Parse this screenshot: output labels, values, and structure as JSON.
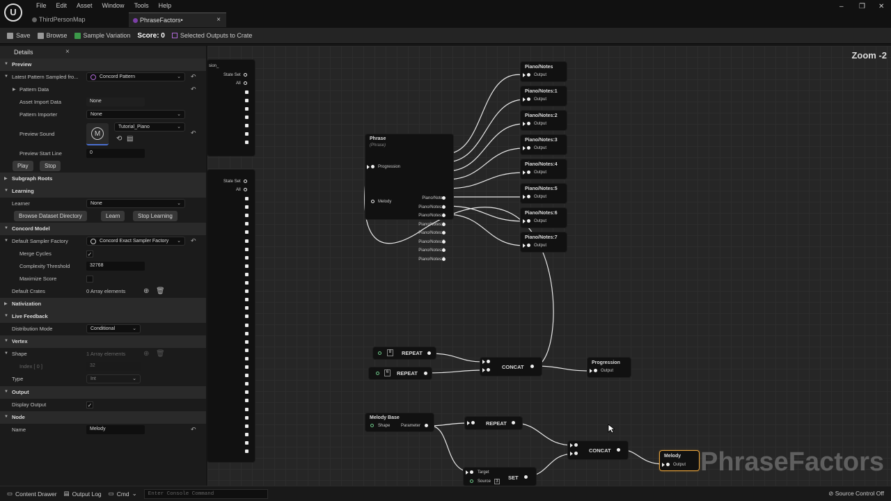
{
  "menu": [
    "File",
    "Edit",
    "Asset",
    "Window",
    "Tools",
    "Help"
  ],
  "tabs": [
    {
      "label": "ThirdPersonMap"
    },
    {
      "label": "PhraseFactors•"
    }
  ],
  "toolbar": {
    "save": "Save",
    "browse": "Browse",
    "sample_variation": "Sample Variation",
    "score": "Score: 0",
    "selected_outputs": "Selected Outputs to Crate"
  },
  "details": {
    "tab_label": "Details",
    "close": "×",
    "preview_section": "Preview",
    "latest_pattern_label": "Latest Pattern Sampled fro...",
    "latest_pattern_value": "Concord Pattern",
    "pattern_data": "Pattern Data",
    "asset_import_label": "Asset Import Data",
    "asset_import_value": "None",
    "pattern_importer_label": "Pattern Importer",
    "pattern_importer_value": "None",
    "preview_sound_label": "Preview Sound",
    "preview_sound_value": "Tutorial_Piano",
    "preview_start_label": "Preview Start Line",
    "preview_start_value": "0",
    "play": "Play",
    "stop": "Stop",
    "subgraph_roots": "Subgraph Roots",
    "learning_section": "Learning",
    "learner_label": "Learner",
    "learner_value": "None",
    "browse_dataset": "Browse Dataset Directory",
    "learn": "Learn",
    "stop_learning": "Stop Learning",
    "concord_model": "Concord Model",
    "default_sampler_label": "Default Sampler Factory",
    "default_sampler_value": "Concord Exact Sampler Factory",
    "merge_cycles": "Merge Cycles",
    "complexity_label": "Complexity Threshold",
    "complexity_value": "32768",
    "maximize_score": "Maximize Score",
    "default_crates_label": "Default Crates",
    "default_crates_value": "0 Array elements",
    "nativization": "Nativization",
    "live_feedback": "Live Feedback",
    "distribution_label": "Distribution Mode",
    "distribution_value": "Conditional",
    "vertex": "Vertex",
    "shape_label": "Shape",
    "shape_value": "1 Array elements",
    "index_label": "Index [ 0 ]",
    "index_value": "32",
    "type_label": "Type",
    "type_value": "Int",
    "output_section": "Output",
    "display_output": "Display Output",
    "node_section": "Node",
    "name_label": "Name",
    "name_value": "Melody"
  },
  "graph": {
    "zoom": "Zoom -2",
    "watermark": "PhraseFactors",
    "partial_title": "sion_",
    "state_set": "State Set",
    "all": "All",
    "phrase_title": "Phrase",
    "phrase_sub": "(Phrase)",
    "progression_pin": "Progression",
    "melody_pin": "Melody",
    "phrase_outputs": [
      "Piano/Notes",
      "Piano/Notes:1",
      "Piano/Notes:2",
      "Piano/Notes:3",
      "Piano/Notes:4",
      "Piano/Notes:5",
      "Piano/Notes:6",
      "Piano/Notes:7"
    ],
    "output_label": "Output",
    "repeat": "REPEAT",
    "concat": "CONCAT",
    "set": "SET",
    "repeat_counts": [
      "8",
      "6"
    ],
    "progression_node": "Progression",
    "melody_base": "Melody Base",
    "shape": "Shape",
    "parameter": "Parameter",
    "target": "Target",
    "source": "Source",
    "source_count": "3",
    "melody_node": "Melody"
  },
  "bottombar": {
    "content_drawer": "Content Drawer",
    "output_log": "Output Log",
    "cmd": "Cmd",
    "console_placeholder": "Enter Console Command",
    "source_control": "Source Control Off"
  },
  "colors": {
    "accent_selected": "#e6a23c",
    "purple": "#b06ad8"
  }
}
